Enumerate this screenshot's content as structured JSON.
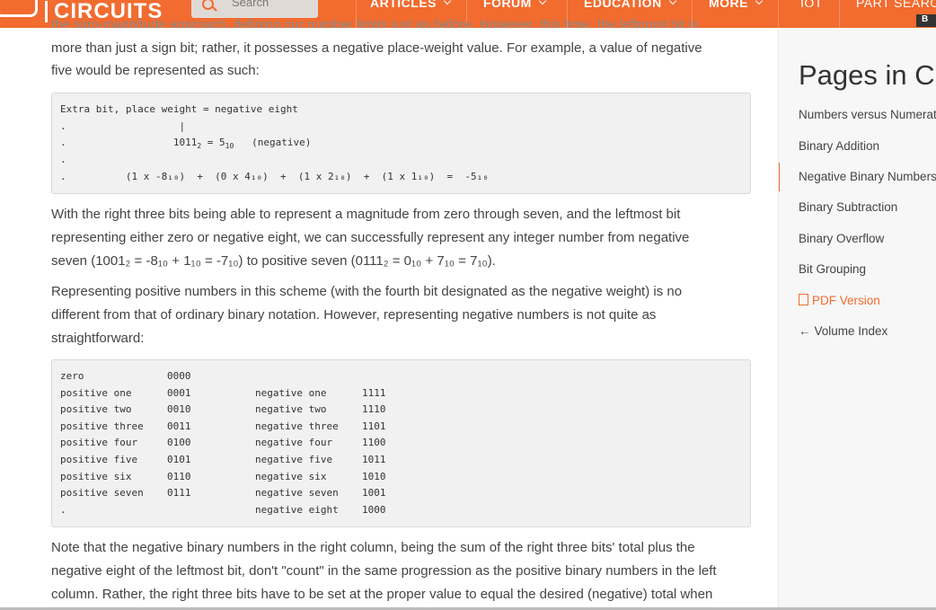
{
  "header": {
    "logo_text": "CIRCUITS",
    "search_placeholder": "Search",
    "nav": [
      "ARTICLES",
      "FORUM",
      "EDUCATION",
      "MORE",
      "IOT",
      "PART SEARCH"
    ],
    "badge": "B"
  },
  "content": {
    "top_partial": "the sign-magnitude approach, defining our number limits just as before. However, this time, the leftmost bit is",
    "para1_line1": "more than just a sign bit; rather, it possesses a negative place-weight value. For example, a value of negative",
    "para1_line2": "five would be represented as such:",
    "code1": {
      "l1": "Extra bit, place weight = negative eight",
      "l2": ".                   |",
      "l3a": ".                  1011",
      "l3b": "2",
      "l3c": " = 5",
      "l3d": "10",
      "l3e": "   (negative)",
      "l4": ".",
      "l5": ".          (1 x -8₁₀)  +  (0 x 4₁₀)  +  (1 x 2₁₀)  +  (1 x 1₁₀)  =  -5₁₀"
    },
    "para2_line1": "With the right three bits being able to represent a magnitude from zero through seven, and the leftmost bit",
    "para2_line2": "representing either zero or negative eight, we can successfully represent any integer number from negative",
    "para2_line3": "seven (1001₂ = -8₁₀ + 1₁₀ = -7₁₀) to positive seven (0111₂ = 0₁₀ + 7₁₀ = 7₁₀).",
    "para3_line1": "Representing positive numbers in this scheme (with the fourth bit designated as the negative weight) is no",
    "para3_line2": "different from that of ordinary binary notation. However, representing negative numbers is not quite as",
    "para3_line3": "straightforward:",
    "table_rows": [
      {
        "left": "zero",
        "lbin": "0000",
        "right": "",
        "rbin": ""
      },
      {
        "left": "positive one",
        "lbin": "0001",
        "right": "negative one",
        "rbin": "1111"
      },
      {
        "left": "positive two",
        "lbin": "0010",
        "right": "negative two",
        "rbin": "1110"
      },
      {
        "left": "positive three",
        "lbin": "0011",
        "right": "negative three",
        "rbin": "1101"
      },
      {
        "left": "positive four",
        "lbin": "0100",
        "right": "negative four",
        "rbin": "1100"
      },
      {
        "left": "positive five",
        "lbin": "0101",
        "right": "negative five",
        "rbin": "1011"
      },
      {
        "left": "positive six",
        "lbin": "0110",
        "right": "negative six",
        "rbin": "1010"
      },
      {
        "left": "positive seven",
        "lbin": "0111",
        "right": "negative seven",
        "rbin": "1001"
      },
      {
        "left": ".",
        "lbin": "",
        "right": "negative eight",
        "rbin": "1000"
      }
    ],
    "para4_line1": "Note that the negative binary numbers in the right column, being the sum of the right three bits' total plus the",
    "para4_line2": "negative eight of the leftmost bit, don't \"count\" in the same progression as the positive binary numbers in the left",
    "para4_line3": "column. Rather, the right three bits have to be set at the proper value to equal the desired (negative) total when"
  },
  "sidebar": {
    "title": "Pages in Chapter",
    "items": [
      "Numbers versus Numeration",
      "Binary Addition",
      "Negative Binary Numbers",
      "Binary Subtraction",
      "Binary Overflow",
      "Bit Grouping"
    ],
    "pdf": "PDF Version",
    "back": "Volume Index"
  },
  "colors": {
    "accent": "#f26b2f"
  }
}
